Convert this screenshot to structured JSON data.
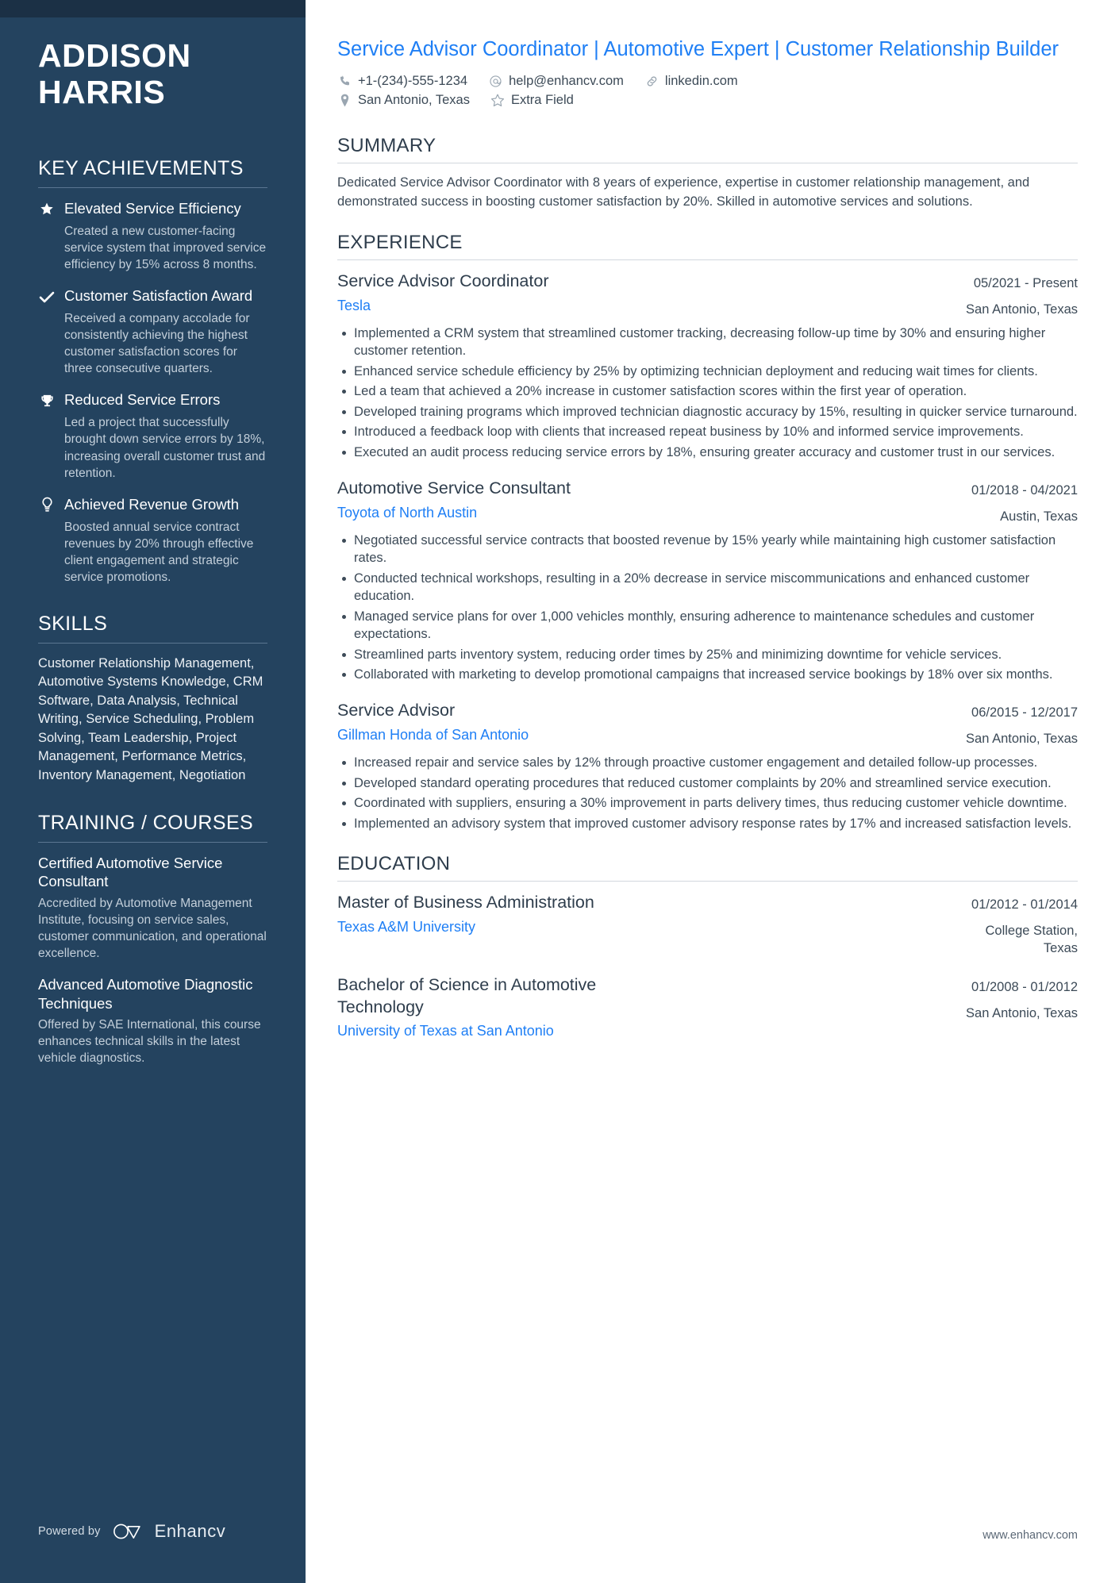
{
  "colors": {
    "sidebar_bg": "#24435f",
    "sidebar_topbar": "#1b3045",
    "accent_blue": "#1f7ff5",
    "body_text": "#3c4a57"
  },
  "sidebar": {
    "name_line1": "ADDISON",
    "name_line2": "HARRIS",
    "achievements_heading": "KEY ACHIEVEMENTS",
    "achievements": [
      {
        "icon": "star-icon",
        "title": "Elevated Service Efficiency",
        "description": "Created a new customer-facing service system that improved service efficiency by 15% across 8 months."
      },
      {
        "icon": "check-icon",
        "title": "Customer Satisfaction Award",
        "description": "Received a company accolade for consistently achieving the highest customer satisfaction scores for three consecutive quarters."
      },
      {
        "icon": "trophy-icon",
        "title": "Reduced Service Errors",
        "description": "Led a project that successfully brought down service errors by 18%, increasing overall customer trust and retention."
      },
      {
        "icon": "lightbulb-icon",
        "title": "Achieved Revenue Growth",
        "description": "Boosted annual service contract revenues by 20% through effective client engagement and strategic service promotions."
      }
    ],
    "skills_heading": "SKILLS",
    "skills_text": "Customer Relationship Management, Automotive Systems Knowledge, CRM Software, Data Analysis, Technical Writing, Service Scheduling, Problem Solving, Team Leadership, Project Management, Performance Metrics, Inventory Management, Negotiation",
    "training_heading": "TRAINING / COURSES",
    "courses": [
      {
        "title": "Certified Automotive Service Consultant",
        "description": "Accredited by Automotive Management Institute, focusing on service sales, customer communication, and operational excellence."
      },
      {
        "title": "Advanced Automotive Diagnostic Techniques",
        "description": "Offered by SAE International, this course enhances technical skills in the latest vehicle diagnostics."
      }
    ],
    "footer": {
      "powered_by": "Powered by",
      "brand": "Enhancv"
    }
  },
  "main": {
    "headline": "Service Advisor Coordinator | Automotive Expert | Customer Relationship Builder",
    "contact": {
      "row1": [
        {
          "icon": "phone-icon",
          "text": "+1-(234)-555-1234"
        },
        {
          "icon": "email-icon",
          "text": "help@enhancv.com"
        },
        {
          "icon": "link-icon",
          "text": "linkedin.com"
        }
      ],
      "row2": [
        {
          "icon": "location-icon",
          "text": "San Antonio, Texas"
        },
        {
          "icon": "star-outline-icon",
          "text": "Extra Field"
        }
      ]
    },
    "summary_heading": "SUMMARY",
    "summary_text": "Dedicated Service Advisor Coordinator with 8 years of experience, expertise in customer relationship management, and demonstrated success in boosting customer satisfaction by 20%. Skilled in automotive services and solutions.",
    "experience_heading": "EXPERIENCE",
    "experience": [
      {
        "title": "Service Advisor Coordinator",
        "organization": "Tesla",
        "date": "05/2021 - Present",
        "location": "San Antonio, Texas",
        "bullets": [
          "Implemented a CRM system that streamlined customer tracking, decreasing follow-up time by 30% and ensuring higher customer retention.",
          "Enhanced service schedule efficiency by 25% by optimizing technician deployment and reducing wait times for clients.",
          "Led a team that achieved a 20% increase in customer satisfaction scores within the first year of operation.",
          "Developed training programs which improved technician diagnostic accuracy by 15%, resulting in quicker service turnaround.",
          "Introduced a feedback loop with clients that increased repeat business by 10% and informed service improvements.",
          "Executed an audit process reducing service errors by 18%, ensuring greater accuracy and customer trust in our services."
        ]
      },
      {
        "title": "Automotive Service Consultant",
        "organization": "Toyota of North Austin",
        "date": "01/2018 - 04/2021",
        "location": "Austin, Texas",
        "bullets": [
          "Negotiated successful service contracts that boosted revenue by 15% yearly while maintaining high customer satisfaction rates.",
          "Conducted technical workshops, resulting in a 20% decrease in service miscommunications and enhanced customer education.",
          "Managed service plans for over 1,000 vehicles monthly, ensuring adherence to maintenance schedules and customer expectations.",
          "Streamlined parts inventory system, reducing order times by 25% and minimizing downtime for vehicle services.",
          "Collaborated with marketing to develop promotional campaigns that increased service bookings by 18% over six months."
        ]
      },
      {
        "title": "Service Advisor",
        "organization": "Gillman Honda of San Antonio",
        "date": "06/2015 - 12/2017",
        "location": "San Antonio, Texas",
        "bullets": [
          "Increased repair and service sales by 12% through proactive customer engagement and detailed follow-up processes.",
          "Developed standard operating procedures that reduced customer complaints by 20% and streamlined service execution.",
          "Coordinated with suppliers, ensuring a 30% improvement in parts delivery times, thus reducing customer vehicle downtime.",
          "Implemented an advisory system that improved customer advisory response rates by 17% and increased satisfaction levels."
        ]
      }
    ],
    "education_heading": "EDUCATION",
    "education": [
      {
        "title": "Master of Business Administration",
        "organization": "Texas A&M University",
        "date": "01/2012 - 01/2014",
        "location": "College Station, Texas"
      },
      {
        "title": "Bachelor of Science in Automotive Technology",
        "organization": "University of Texas at San Antonio",
        "date": "01/2008 - 01/2012",
        "location": "San Antonio, Texas"
      }
    ],
    "footer_url": "www.enhancv.com"
  }
}
